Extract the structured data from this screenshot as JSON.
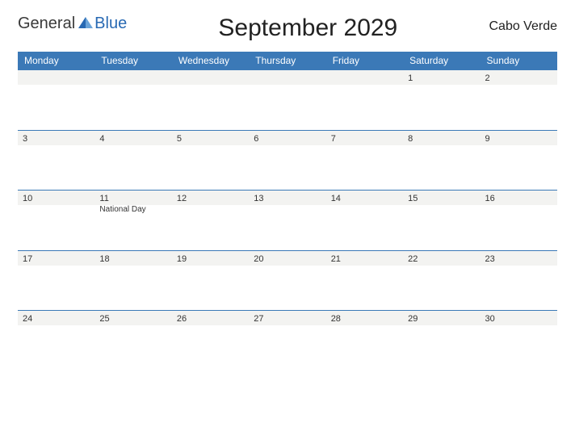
{
  "brand": {
    "part1": "General",
    "part2": "Blue"
  },
  "title": "September 2029",
  "region": "Cabo Verde",
  "dayHeaders": [
    "Monday",
    "Tuesday",
    "Wednesday",
    "Thursday",
    "Friday",
    "Saturday",
    "Sunday"
  ],
  "weeks": [
    {
      "days": [
        "",
        "",
        "",
        "",
        "",
        "1",
        "2"
      ],
      "events": [
        "",
        "",
        "",
        "",
        "",
        "",
        ""
      ]
    },
    {
      "days": [
        "3",
        "4",
        "5",
        "6",
        "7",
        "8",
        "9"
      ],
      "events": [
        "",
        "",
        "",
        "",
        "",
        "",
        ""
      ]
    },
    {
      "days": [
        "10",
        "11",
        "12",
        "13",
        "14",
        "15",
        "16"
      ],
      "events": [
        "",
        "National Day",
        "",
        "",
        "",
        "",
        ""
      ]
    },
    {
      "days": [
        "17",
        "18",
        "19",
        "20",
        "21",
        "22",
        "23"
      ],
      "events": [
        "",
        "",
        "",
        "",
        "",
        "",
        ""
      ]
    },
    {
      "days": [
        "24",
        "25",
        "26",
        "27",
        "28",
        "29",
        "30"
      ],
      "events": [
        "",
        "",
        "",
        "",
        "",
        "",
        ""
      ]
    }
  ]
}
